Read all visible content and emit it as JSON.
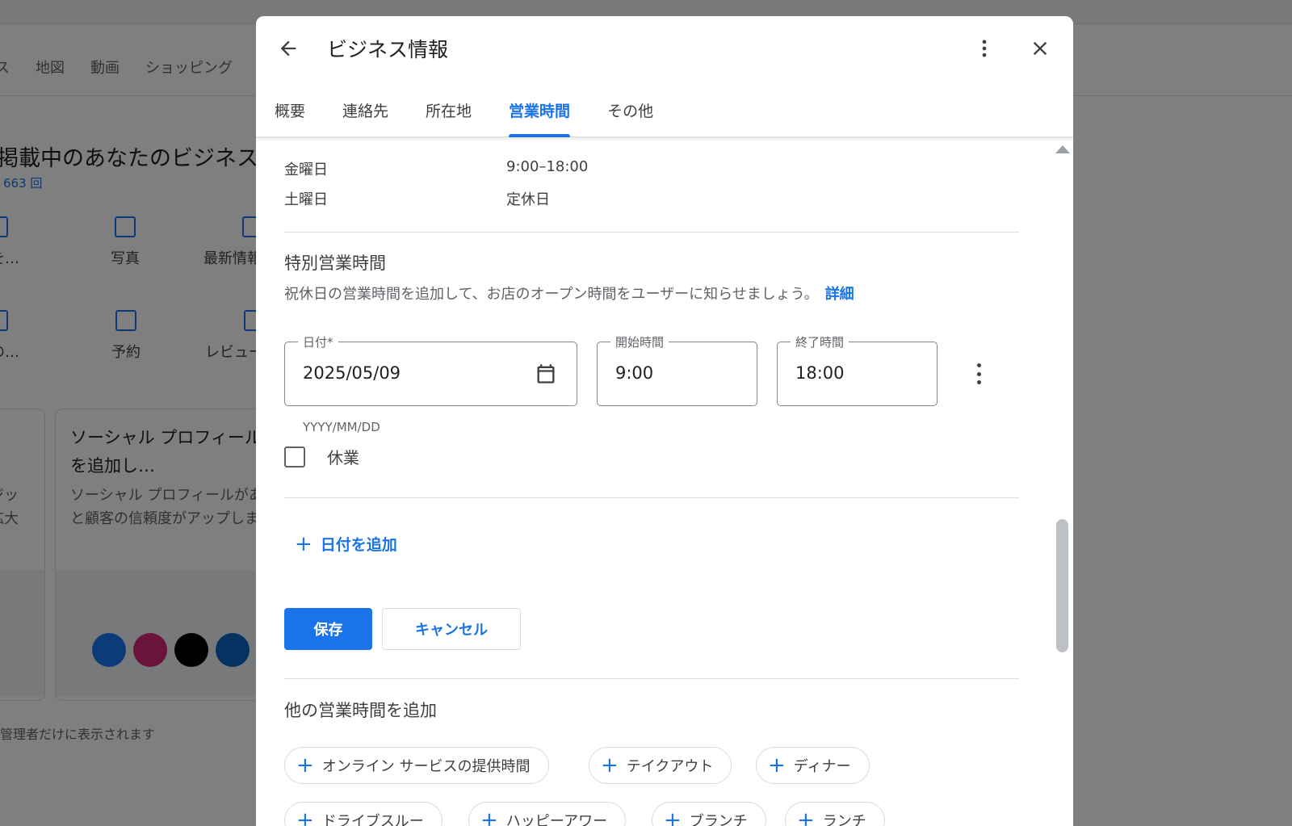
{
  "background": {
    "nav": [
      "ス",
      "地図",
      "動画",
      "ショッピング"
    ],
    "heading": "掲載中のあなたのビジネス",
    "views": "663 回",
    "actions_row1": [
      "ミを…",
      "写真",
      "最新情報"
    ],
    "actions_row2": [
      "スの…",
      "予約",
      "レビュー"
    ],
    "card_left_body": "ジッ\n拡大",
    "card_title": "ソーシャル プロフィールを追加し…",
    "card_body": "ソーシャル プロフィールがあると顧客の信頼度がアップします",
    "footer": "管理者だけに表示されます"
  },
  "dialog": {
    "title": "ビジネス情報",
    "tabs": [
      {
        "label": "概要"
      },
      {
        "label": "連絡先"
      },
      {
        "label": "所在地"
      },
      {
        "label": "営業時間"
      },
      {
        "label": "その他"
      }
    ],
    "active_tab": "営業時間",
    "hours": [
      {
        "day": "金曜日",
        "value": "9:00–18:00"
      },
      {
        "day": "土曜日",
        "value": "定休日"
      }
    ],
    "special": {
      "title": "特別営業時間",
      "description": "祝休日の営業時間を追加して、お店のオープン時間をユーザーに知らせましょう。",
      "learn_more": "詳細",
      "date_label": "日付*",
      "date_value": "2025/05/09",
      "date_hint": "YYYY/MM/DD",
      "start_label": "開始時間",
      "start_value": "9:00",
      "end_label": "終了時間",
      "end_value": "18:00",
      "closed_label": "休業",
      "add_date": "日付を追加"
    },
    "buttons": {
      "save": "保存",
      "cancel": "キャンセル"
    },
    "more_hours": {
      "title": "他の営業時間を追加",
      "chips": [
        "オンライン サービスの提供時間",
        "テイクアウト",
        "ディナー",
        "ドライブスルー",
        "ハッピーアワー",
        "ブランチ",
        "ランチ"
      ]
    }
  },
  "colors": {
    "accent": "#1a73e8"
  }
}
